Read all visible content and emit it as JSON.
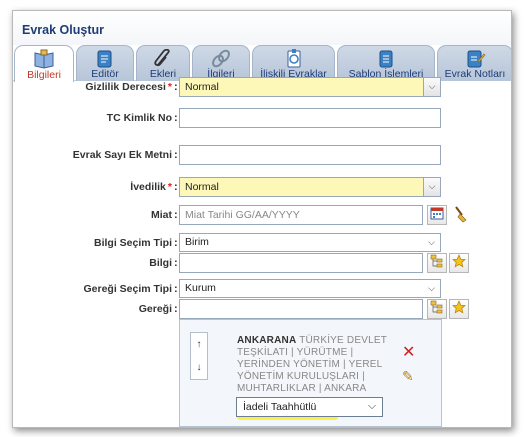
{
  "window": {
    "title": "Evrak Oluştur"
  },
  "tabs": [
    {
      "label": "Bilgileri",
      "icon": "book-icon",
      "active": true
    },
    {
      "label": "Editör",
      "icon": "document-edit-icon",
      "active": false
    },
    {
      "label": "Ekleri",
      "icon": "paperclip-icon",
      "active": false
    },
    {
      "label": "İlgileri",
      "icon": "chain-link-icon",
      "active": false
    },
    {
      "label": "İlişkili Evraklar",
      "icon": "related-documents-icon",
      "active": false
    },
    {
      "label": "Şablon İşlemleri",
      "icon": "template-document-icon",
      "active": false
    },
    {
      "label": "Evrak Notları",
      "icon": "note-edit-icon",
      "active": false
    }
  ],
  "form": {
    "gizlilik": {
      "label": "Gizlilik Derecesi",
      "required": "*",
      "value": "Normal"
    },
    "tc": {
      "label": "TC Kimlik No",
      "value": ""
    },
    "sayi_ek": {
      "label": "Evrak Sayı Ek Metni",
      "value": ""
    },
    "ivedilik": {
      "label": "İvedilik",
      "required": "*",
      "value": "Normal"
    },
    "miat": {
      "label": "Miat",
      "placeholder": "Miat Tarihi GG/AA/YYYY",
      "value": ""
    },
    "bilgi_secim": {
      "label": "Bilgi Seçim Tipi",
      "value": "Birim"
    },
    "bilgi": {
      "label": "Bilgi",
      "value": ""
    },
    "geregi_secim": {
      "label": "Gereği Seçim Tipi",
      "value": "Kurum"
    },
    "geregi": {
      "label": "Gereği",
      "value": ""
    }
  },
  "recipient": {
    "name": "ANKARANA",
    "detail": "TÜRKİYE DEVLET TEŞKİLATI | YÜRÜTME | YERİNDEN YÖNETİM | YEREL YÖNETİM KURULUŞLARI | MUHTARLIKLAR | ANKARA",
    "delivery": "İadeli Taahhütlü",
    "up_arrow": "↑",
    "down_arrow": "↓"
  },
  "colors": {
    "required_field": "#fdf7b8",
    "highlight": "#f7f03a",
    "title": "#1e3c78",
    "active_tab": "#c0392b"
  }
}
